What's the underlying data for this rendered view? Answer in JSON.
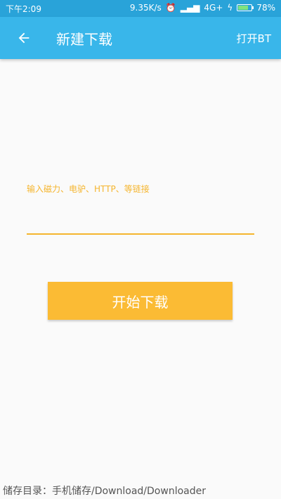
{
  "status_bar": {
    "time": "下午2:09",
    "speed": "9.35K/s",
    "network": "4G+",
    "battery": "78%",
    "battery_level": 0.78
  },
  "app_bar": {
    "back_icon": "arrow-left-icon",
    "title": "新建下载",
    "bt_label": "打开BT"
  },
  "form": {
    "url_label": "输入磁力、电驴、HTTP、等链接",
    "url_value": "",
    "start_button": "开始下载"
  },
  "footer": {
    "storage_path": "储存目录：手机储存/Download/Downloader"
  },
  "colors": {
    "status_bar": "#29a3d9",
    "app_bar": "#39b6ea",
    "accent": "#f5b52e",
    "button": "#fbbb34"
  }
}
